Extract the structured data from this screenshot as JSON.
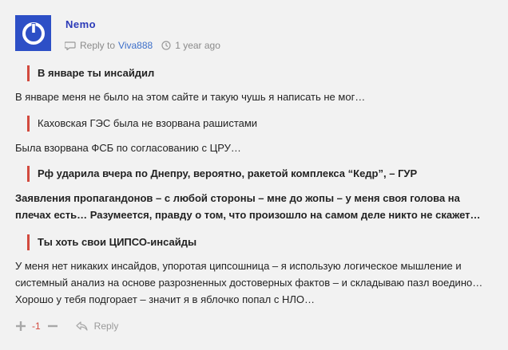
{
  "comment": {
    "author": "Nemo",
    "avatar_color": "#2d4fc6",
    "meta": {
      "reply_prefix": "Reply to",
      "reply_user": "Viva888",
      "time": "1 year ago"
    },
    "body": {
      "quote1": "В январе ты инсайдил",
      "text1": "В январе меня не было на этом сайте и такую чушь я написать не мог…",
      "quote2": "Каховская ГЭС была не взорвана рашистами",
      "text2": "Была взорвана ФСБ по согласованию с ЦРУ…",
      "quote3": "Рф ударила вчера по Днепру, вероятно, ракетой комплекса “Кедр”, – ГУР",
      "text3": "Заявления пропагандонов – с любой стороны – мне до жопы – у меня своя голова на плечах есть… Разумеется, правду о том, что произошло на самом деле никто не скажет…",
      "quote4": "Ты хоть свои ЦИПСО-инсайды",
      "text4": "У меня нет никаких инсайдов, упоротая ципсошница – я использую логическое мышление и системный анализ на основе разрозненных достоверных фактов – и складываю пазл воедино… Хорошо у тебя подгорает – значит я в яблочко попал с НЛО…"
    },
    "actions": {
      "score": "-1",
      "reply_label": "Reply"
    },
    "colors": {
      "accent": "#d24a3e",
      "author": "#2b3ab8",
      "link": "#3d6fc9",
      "muted": "#8b8b8b"
    }
  }
}
